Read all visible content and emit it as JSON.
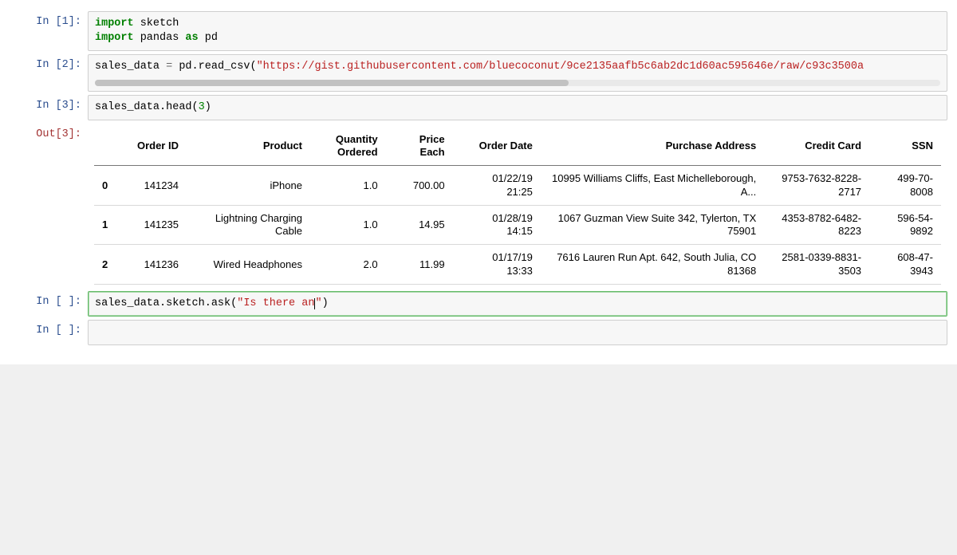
{
  "cells": {
    "c1": {
      "prompt": "In [1]:",
      "code": {
        "l1_kw1": "import",
        "l1_mod": " sketch",
        "l2_kw1": "import",
        "l2_mod": " pandas ",
        "l2_kw2": "as",
        "l2_alias": " pd"
      }
    },
    "c2": {
      "prompt": "In [2]:",
      "code": {
        "pre": "sales_data ",
        "eq": "=",
        "mid": " pd.read_csv(",
        "str": "\"https://gist.githubusercontent.com/bluecoconut/9ce2135aafb5c6ab2dc1d60ac595646e/raw/c93c3500a"
      }
    },
    "c3": {
      "prompt": "In [3]:",
      "out_prompt": "Out[3]:",
      "code": {
        "pre": "sales_data.head(",
        "num": "3",
        "post": ")"
      }
    },
    "c4": {
      "prompt": "In [ ]:",
      "code": {
        "pre": "sales_data.sketch.ask(",
        "str": "\"Is there an",
        "post": "\")",
        "cursor_after_str": true
      }
    },
    "c5": {
      "prompt": "In [ ]:"
    }
  },
  "table": {
    "headers": {
      "idx": "",
      "order_id": "Order\nID",
      "product": "Product",
      "qty": "Quantity\nOrdered",
      "price": "Price\nEach",
      "date": "Order Date",
      "addr": "Purchase Address",
      "cc": "Credit Card",
      "ssn": "SSN"
    },
    "rows": [
      {
        "idx": "0",
        "order_id": "141234",
        "product": "iPhone",
        "qty": "1.0",
        "price": "700.00",
        "date": "01/22/19\n21:25",
        "addr": "10995 Williams Cliffs, East Michelleborough, A...",
        "cc": "9753-7632-8228-\n2717",
        "ssn": "499-70-\n8008"
      },
      {
        "idx": "1",
        "order_id": "141235",
        "product": "Lightning Charging\nCable",
        "qty": "1.0",
        "price": "14.95",
        "date": "01/28/19\n14:15",
        "addr": "1067 Guzman View Suite 342, Tylerton, TX\n75901",
        "cc": "4353-8782-6482-\n8223",
        "ssn": "596-54-\n9892"
      },
      {
        "idx": "2",
        "order_id": "141236",
        "product": "Wired Headphones",
        "qty": "2.0",
        "price": "11.99",
        "date": "01/17/19\n13:33",
        "addr": "7616 Lauren Run Apt. 642, South Julia, CO\n81368",
        "cc": "2581-0339-8831-\n3503",
        "ssn": "608-47-\n3943"
      }
    ]
  }
}
